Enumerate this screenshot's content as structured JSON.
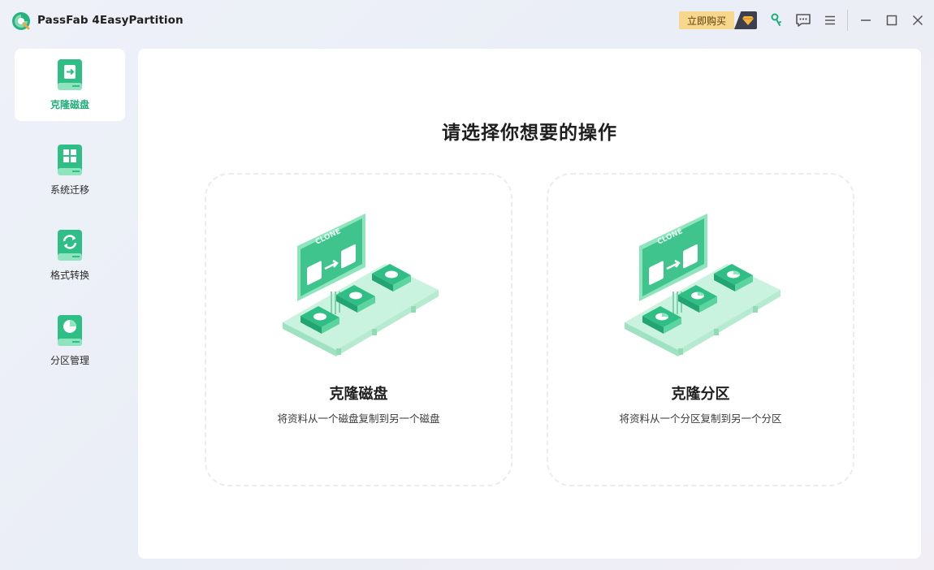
{
  "app": {
    "title": "PassFab 4EasyPartition"
  },
  "titlebar": {
    "buy_label": "立即购买",
    "icons": [
      "key-icon",
      "feedback-icon",
      "menu-icon",
      "minimize-icon",
      "maximize-icon",
      "close-icon"
    ]
  },
  "sidebar": {
    "items": [
      {
        "label": "克隆磁盘",
        "icon": "clone-disk-icon",
        "active": true
      },
      {
        "label": "系统迁移",
        "icon": "system-migration-icon",
        "active": false
      },
      {
        "label": "格式转换",
        "icon": "format-convert-icon",
        "active": false
      },
      {
        "label": "分区管理",
        "icon": "partition-manage-icon",
        "active": false
      }
    ]
  },
  "main": {
    "title": "请选择你想要的操作",
    "cards": [
      {
        "title": "克隆磁盘",
        "desc": "将资料从一个磁盘复制到另一个磁盘",
        "art_text": "CLONE"
      },
      {
        "title": "克隆分区",
        "desc": "将资料从一个分区复制到另一个分区",
        "art_text": "CLONE"
      }
    ]
  },
  "colors": {
    "accent": "#1fae78",
    "accent_light": "#8ee5bd",
    "buy_bg": "#f7d78c",
    "panel": "#ffffff"
  }
}
